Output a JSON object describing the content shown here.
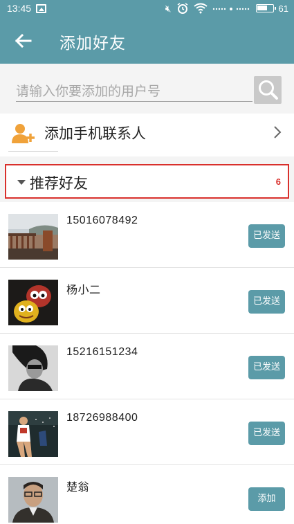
{
  "status_bar": {
    "time": "13:45",
    "battery": "61",
    "icons": [
      "picture-icon",
      "mute-icon",
      "alarm-icon",
      "wifi-icon",
      "signal-icon",
      "battery-icon"
    ]
  },
  "header": {
    "title": "添加好友",
    "back_icon": "arrow-left-icon"
  },
  "search": {
    "placeholder": "请输入你要添加的用户号",
    "icon": "search-icon"
  },
  "phone_contacts": {
    "label": "添加手机联系人",
    "icon": "add-contact-icon"
  },
  "recommend": {
    "label": "推荐好友",
    "count": "6"
  },
  "friends": [
    {
      "name": "15016078492",
      "action": "已发送"
    },
    {
      "name": "杨小二",
      "action": "已发送"
    },
    {
      "name": "15216151234",
      "action": "已发送"
    },
    {
      "name": "18726988400",
      "action": "已发送"
    },
    {
      "name": "楚翁",
      "action": "添加"
    }
  ],
  "colors": {
    "accent": "#5b9ba8",
    "highlight_border": "#d9302c",
    "contact_icon": "#f0a23a"
  }
}
